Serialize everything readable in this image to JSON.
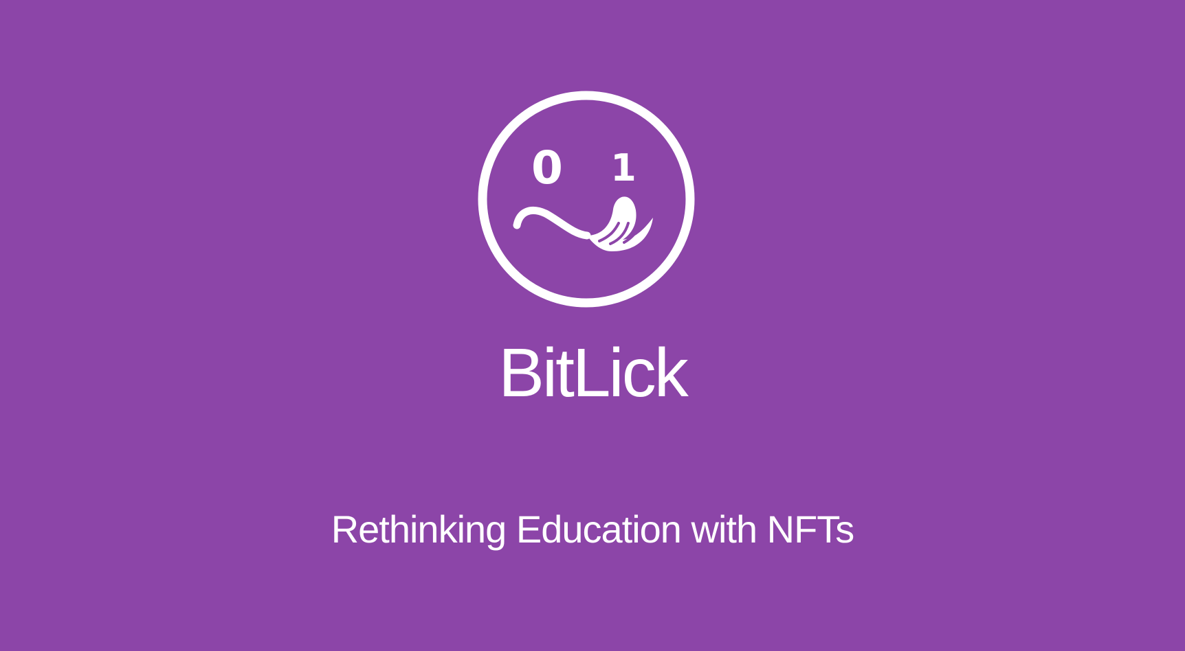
{
  "slide": {
    "title": "BitLick",
    "subtitle": "Rethinking Education with NFTs",
    "background_color": "#8c45a8",
    "foreground_color": "#ffffff"
  },
  "logo": {
    "icon": "bitlick-smiley-tongue-logo",
    "left_glyph": "0",
    "right_glyph": "1"
  }
}
